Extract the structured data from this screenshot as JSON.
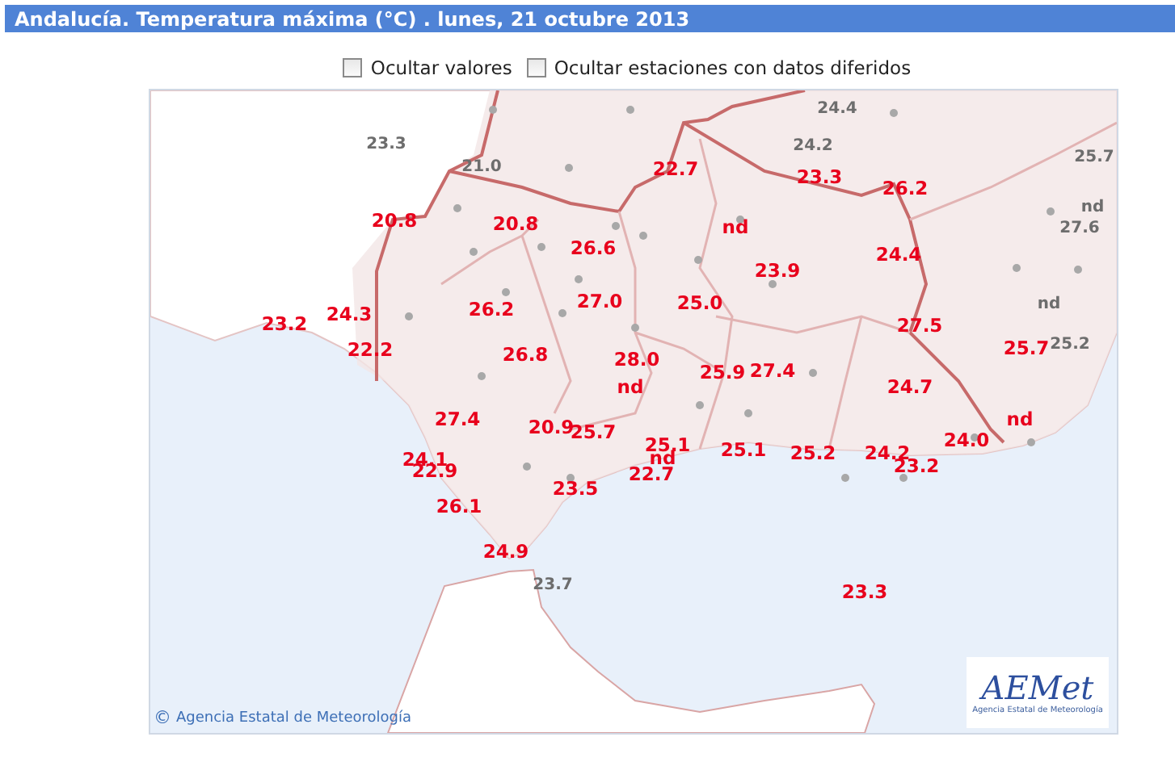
{
  "header": {
    "title": "Andalucía. Temperatura máxima (°C) . lunes, 21 octubre 2013"
  },
  "options": [
    {
      "label": "Ocultar valores",
      "checked": false
    },
    {
      "label": "Ocultar estaciones con datos diferidos",
      "checked": false
    }
  ],
  "map": {
    "labels": [
      {
        "text": "24.4",
        "kind": "neighbor"
      },
      {
        "text": "23.3",
        "kind": "neighbor"
      },
      {
        "text": "21.0",
        "kind": "neighbor"
      },
      {
        "text": "24.2",
        "kind": "neighbor"
      },
      {
        "text": "25.7",
        "kind": "neighbor"
      },
      {
        "text": "nd",
        "kind": "neighbor"
      },
      {
        "text": "27.6",
        "kind": "neighbor"
      },
      {
        "text": "nd",
        "kind": "neighbor"
      },
      {
        "text": "25.2",
        "kind": "neighbor"
      },
      {
        "text": "23.7",
        "kind": "neighbor"
      },
      {
        "text": "22.7",
        "kind": "local"
      },
      {
        "text": "23.3",
        "kind": "local"
      },
      {
        "text": "26.2",
        "kind": "local"
      },
      {
        "text": "20.8",
        "kind": "local"
      },
      {
        "text": "20.8",
        "kind": "local"
      },
      {
        "text": "nd",
        "kind": "local"
      },
      {
        "text": "26.6",
        "kind": "local"
      },
      {
        "text": "24.4",
        "kind": "local"
      },
      {
        "text": "23.9",
        "kind": "local"
      },
      {
        "text": "27.0",
        "kind": "local"
      },
      {
        "text": "25.0",
        "kind": "local"
      },
      {
        "text": "23.2",
        "kind": "local"
      },
      {
        "text": "24.3",
        "kind": "local"
      },
      {
        "text": "26.2",
        "kind": "local"
      },
      {
        "text": "27.5",
        "kind": "local"
      },
      {
        "text": "22.2",
        "kind": "local"
      },
      {
        "text": "25.7",
        "kind": "local"
      },
      {
        "text": "26.8",
        "kind": "local"
      },
      {
        "text": "28.0",
        "kind": "local"
      },
      {
        "text": "25.9",
        "kind": "local"
      },
      {
        "text": "27.4",
        "kind": "local"
      },
      {
        "text": "nd",
        "kind": "local"
      },
      {
        "text": "24.7",
        "kind": "local"
      },
      {
        "text": "27.4",
        "kind": "local"
      },
      {
        "text": "20.9",
        "kind": "local"
      },
      {
        "text": "25.7",
        "kind": "local"
      },
      {
        "text": "nd",
        "kind": "local"
      },
      {
        "text": "25.1",
        "kind": "local"
      },
      {
        "text": "25.1",
        "kind": "local"
      },
      {
        "text": "25.2",
        "kind": "local"
      },
      {
        "text": "24.2",
        "kind": "local"
      },
      {
        "text": "24.0",
        "kind": "local"
      },
      {
        "text": "24.1",
        "kind": "local"
      },
      {
        "text": "22.9",
        "kind": "local"
      },
      {
        "text": "nd",
        "kind": "local"
      },
      {
        "text": "22.7",
        "kind": "local"
      },
      {
        "text": "23.2",
        "kind": "local"
      },
      {
        "text": "23.5",
        "kind": "local"
      },
      {
        "text": "26.1",
        "kind": "local"
      },
      {
        "text": "24.9",
        "kind": "local"
      },
      {
        "text": "23.3",
        "kind": "local"
      }
    ],
    "copyright": {
      "symbol": "©",
      "text": "Agencia Estatal de Meteorología"
    },
    "logo": {
      "wordmark": "AEMet",
      "caption": "Agencia Estatal de Meteorología"
    }
  }
}
